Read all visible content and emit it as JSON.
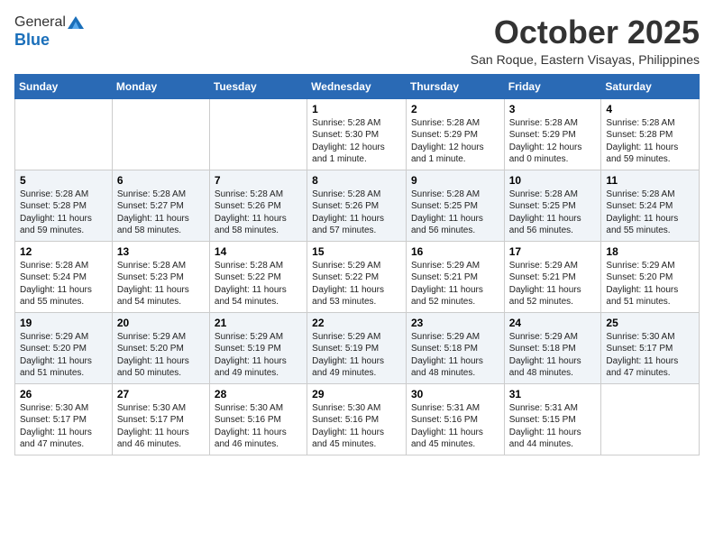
{
  "logo": {
    "general": "General",
    "blue": "Blue"
  },
  "title": "October 2025",
  "location": "San Roque, Eastern Visayas, Philippines",
  "days_of_week": [
    "Sunday",
    "Monday",
    "Tuesday",
    "Wednesday",
    "Thursday",
    "Friday",
    "Saturday"
  ],
  "weeks": [
    [
      {
        "day": "",
        "info": ""
      },
      {
        "day": "",
        "info": ""
      },
      {
        "day": "",
        "info": ""
      },
      {
        "day": "1",
        "info": "Sunrise: 5:28 AM\nSunset: 5:30 PM\nDaylight: 12 hours\nand 1 minute."
      },
      {
        "day": "2",
        "info": "Sunrise: 5:28 AM\nSunset: 5:29 PM\nDaylight: 12 hours\nand 1 minute."
      },
      {
        "day": "3",
        "info": "Sunrise: 5:28 AM\nSunset: 5:29 PM\nDaylight: 12 hours\nand 0 minutes."
      },
      {
        "day": "4",
        "info": "Sunrise: 5:28 AM\nSunset: 5:28 PM\nDaylight: 11 hours\nand 59 minutes."
      }
    ],
    [
      {
        "day": "5",
        "info": "Sunrise: 5:28 AM\nSunset: 5:28 PM\nDaylight: 11 hours\nand 59 minutes."
      },
      {
        "day": "6",
        "info": "Sunrise: 5:28 AM\nSunset: 5:27 PM\nDaylight: 11 hours\nand 58 minutes."
      },
      {
        "day": "7",
        "info": "Sunrise: 5:28 AM\nSunset: 5:26 PM\nDaylight: 11 hours\nand 58 minutes."
      },
      {
        "day": "8",
        "info": "Sunrise: 5:28 AM\nSunset: 5:26 PM\nDaylight: 11 hours\nand 57 minutes."
      },
      {
        "day": "9",
        "info": "Sunrise: 5:28 AM\nSunset: 5:25 PM\nDaylight: 11 hours\nand 56 minutes."
      },
      {
        "day": "10",
        "info": "Sunrise: 5:28 AM\nSunset: 5:25 PM\nDaylight: 11 hours\nand 56 minutes."
      },
      {
        "day": "11",
        "info": "Sunrise: 5:28 AM\nSunset: 5:24 PM\nDaylight: 11 hours\nand 55 minutes."
      }
    ],
    [
      {
        "day": "12",
        "info": "Sunrise: 5:28 AM\nSunset: 5:24 PM\nDaylight: 11 hours\nand 55 minutes."
      },
      {
        "day": "13",
        "info": "Sunrise: 5:28 AM\nSunset: 5:23 PM\nDaylight: 11 hours\nand 54 minutes."
      },
      {
        "day": "14",
        "info": "Sunrise: 5:28 AM\nSunset: 5:22 PM\nDaylight: 11 hours\nand 54 minutes."
      },
      {
        "day": "15",
        "info": "Sunrise: 5:29 AM\nSunset: 5:22 PM\nDaylight: 11 hours\nand 53 minutes."
      },
      {
        "day": "16",
        "info": "Sunrise: 5:29 AM\nSunset: 5:21 PM\nDaylight: 11 hours\nand 52 minutes."
      },
      {
        "day": "17",
        "info": "Sunrise: 5:29 AM\nSunset: 5:21 PM\nDaylight: 11 hours\nand 52 minutes."
      },
      {
        "day": "18",
        "info": "Sunrise: 5:29 AM\nSunset: 5:20 PM\nDaylight: 11 hours\nand 51 minutes."
      }
    ],
    [
      {
        "day": "19",
        "info": "Sunrise: 5:29 AM\nSunset: 5:20 PM\nDaylight: 11 hours\nand 51 minutes."
      },
      {
        "day": "20",
        "info": "Sunrise: 5:29 AM\nSunset: 5:20 PM\nDaylight: 11 hours\nand 50 minutes."
      },
      {
        "day": "21",
        "info": "Sunrise: 5:29 AM\nSunset: 5:19 PM\nDaylight: 11 hours\nand 49 minutes."
      },
      {
        "day": "22",
        "info": "Sunrise: 5:29 AM\nSunset: 5:19 PM\nDaylight: 11 hours\nand 49 minutes."
      },
      {
        "day": "23",
        "info": "Sunrise: 5:29 AM\nSunset: 5:18 PM\nDaylight: 11 hours\nand 48 minutes."
      },
      {
        "day": "24",
        "info": "Sunrise: 5:29 AM\nSunset: 5:18 PM\nDaylight: 11 hours\nand 48 minutes."
      },
      {
        "day": "25",
        "info": "Sunrise: 5:30 AM\nSunset: 5:17 PM\nDaylight: 11 hours\nand 47 minutes."
      }
    ],
    [
      {
        "day": "26",
        "info": "Sunrise: 5:30 AM\nSunset: 5:17 PM\nDaylight: 11 hours\nand 47 minutes."
      },
      {
        "day": "27",
        "info": "Sunrise: 5:30 AM\nSunset: 5:17 PM\nDaylight: 11 hours\nand 46 minutes."
      },
      {
        "day": "28",
        "info": "Sunrise: 5:30 AM\nSunset: 5:16 PM\nDaylight: 11 hours\nand 46 minutes."
      },
      {
        "day": "29",
        "info": "Sunrise: 5:30 AM\nSunset: 5:16 PM\nDaylight: 11 hours\nand 45 minutes."
      },
      {
        "day": "30",
        "info": "Sunrise: 5:31 AM\nSunset: 5:16 PM\nDaylight: 11 hours\nand 45 minutes."
      },
      {
        "day": "31",
        "info": "Sunrise: 5:31 AM\nSunset: 5:15 PM\nDaylight: 11 hours\nand 44 minutes."
      },
      {
        "day": "",
        "info": ""
      }
    ]
  ]
}
